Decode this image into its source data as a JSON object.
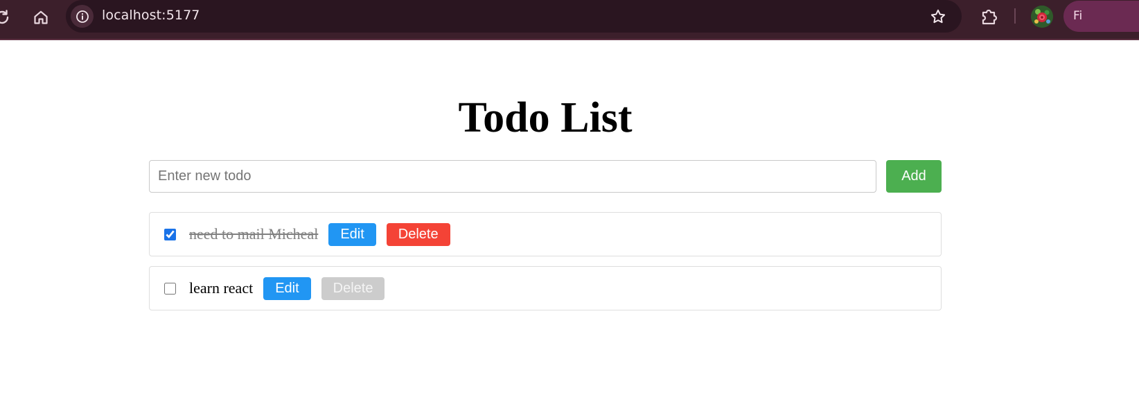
{
  "browser": {
    "url": "localhost:5177",
    "profile_label": "Fi",
    "colors": {
      "toolbar": "#3c1f2b",
      "omnibox": "#2a1520",
      "profile_chip": "#6b2a52"
    }
  },
  "page": {
    "title": "Todo List",
    "input": {
      "placeholder": "Enter new todo",
      "value": ""
    },
    "add_label": "Add",
    "colors": {
      "add": "#4caf50",
      "edit": "#2196f3",
      "delete": "#f44336",
      "delete_disabled": "#cccccc"
    }
  },
  "todos": [
    {
      "text": "need to mail Micheal",
      "completed": true,
      "edit_label": "Edit",
      "delete_label": "Delete",
      "delete_enabled": true
    },
    {
      "text": "learn react",
      "completed": false,
      "edit_label": "Edit",
      "delete_label": "Delete",
      "delete_enabled": false
    }
  ],
  "icons": {
    "reload": "reload-icon",
    "home": "home-icon",
    "site_info": "info-icon",
    "bookmark": "star-icon",
    "extensions": "puzzle-icon",
    "avatar": "avatar"
  }
}
